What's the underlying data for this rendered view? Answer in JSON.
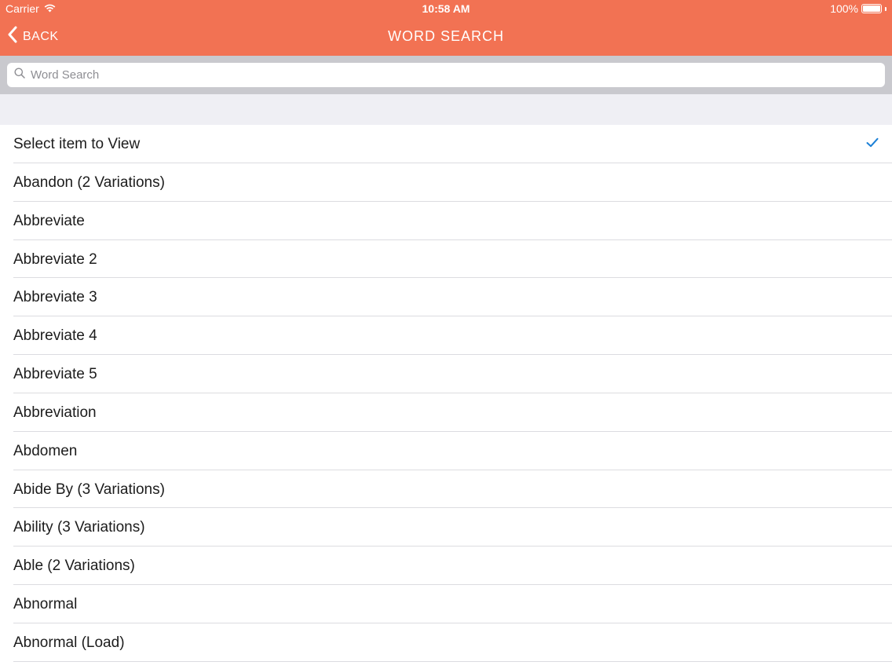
{
  "status_bar": {
    "carrier": "Carrier",
    "time": "10:58 AM",
    "battery": "100%"
  },
  "nav": {
    "back_label": "BACK",
    "title": "WORD SEARCH",
    "accent_color": "#f27253"
  },
  "search": {
    "placeholder": "Word Search",
    "value": ""
  },
  "list": {
    "items": [
      {
        "label": "Select item to View",
        "selected": true
      },
      {
        "label": "Abandon (2 Variations)"
      },
      {
        "label": "Abbreviate"
      },
      {
        "label": "Abbreviate 2"
      },
      {
        "label": "Abbreviate 3"
      },
      {
        "label": "Abbreviate 4"
      },
      {
        "label": "Abbreviate 5"
      },
      {
        "label": "Abbreviation"
      },
      {
        "label": "Abdomen"
      },
      {
        "label": "Abide By (3 Variations)"
      },
      {
        "label": "Ability (3 Variations)"
      },
      {
        "label": "Able (2 Variations)"
      },
      {
        "label": "Abnormal"
      },
      {
        "label": "Abnormal (Load)"
      }
    ],
    "check_color": "#1a7fd6"
  }
}
